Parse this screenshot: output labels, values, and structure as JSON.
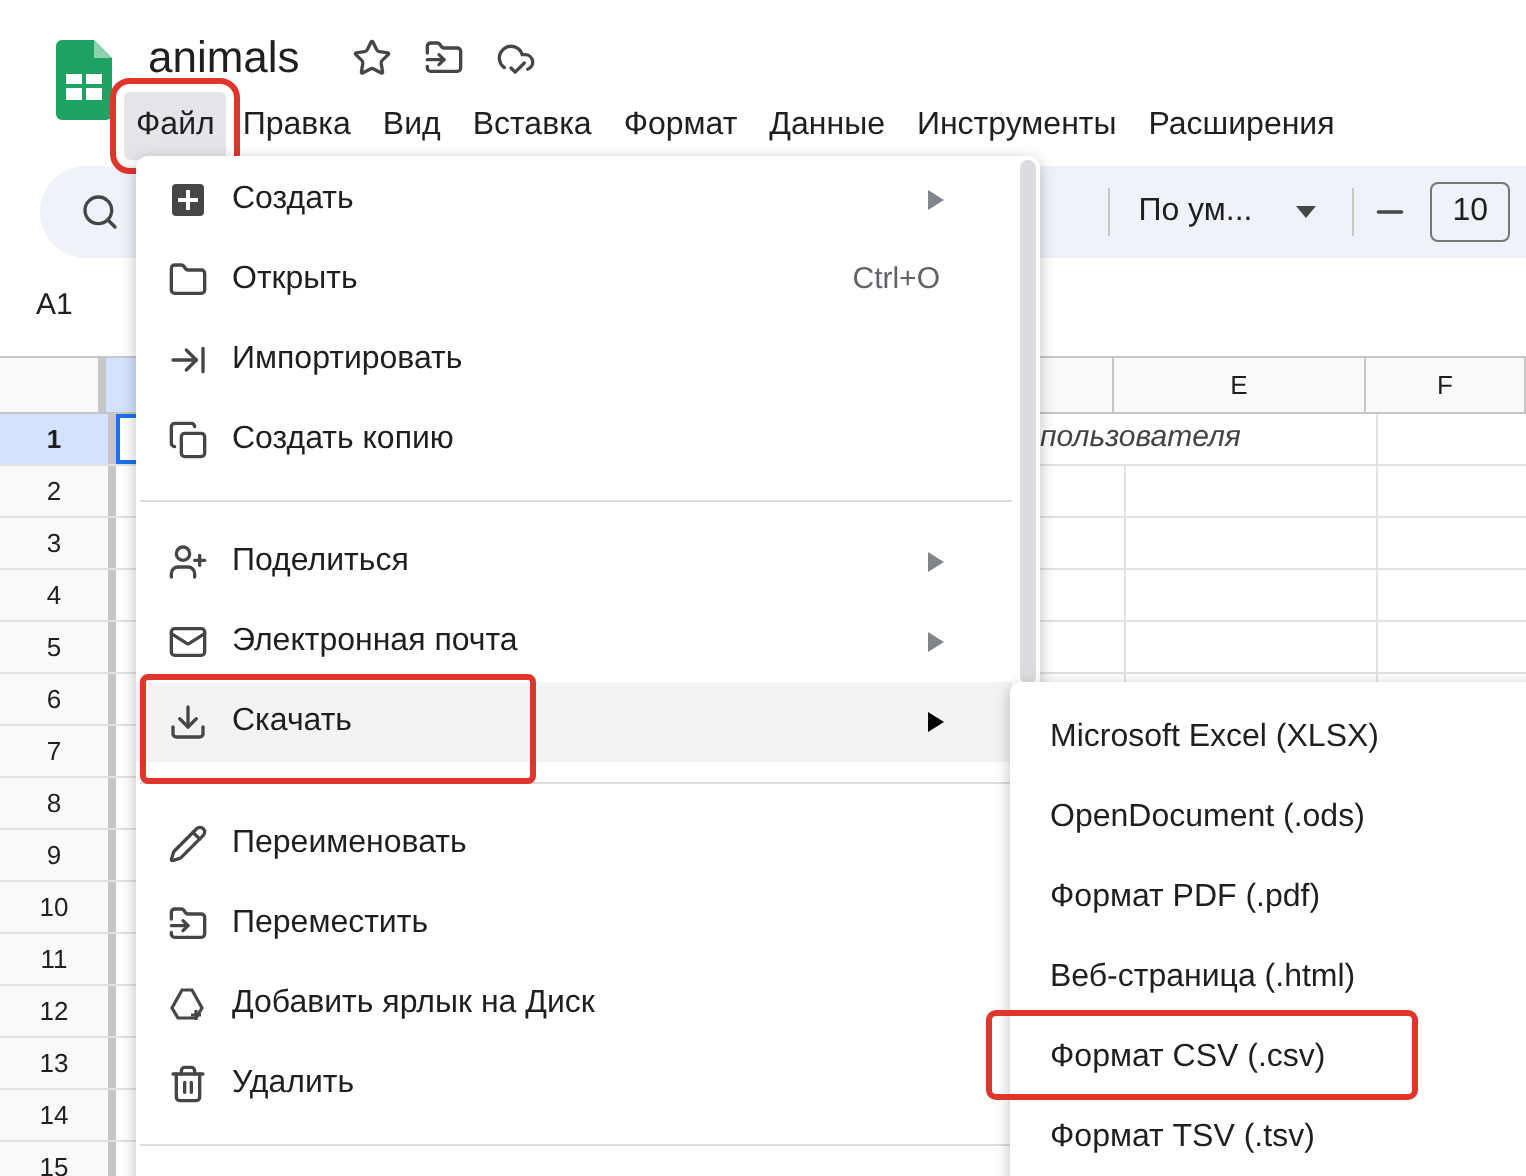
{
  "document": {
    "title": "animals"
  },
  "menubar": [
    {
      "label": "Файл",
      "selected": true,
      "outlined": true
    },
    {
      "label": "Правка",
      "selected": false,
      "outlined": false
    },
    {
      "label": "Вид",
      "selected": false,
      "outlined": false
    },
    {
      "label": "Вставка",
      "selected": false,
      "outlined": false
    },
    {
      "label": "Формат",
      "selected": false,
      "outlined": false
    },
    {
      "label": "Данные",
      "selected": false,
      "outlined": false
    },
    {
      "label": "Инструменты",
      "selected": false,
      "outlined": false
    },
    {
      "label": "Расширения",
      "selected": false,
      "outlined": false
    }
  ],
  "toolbar": {
    "font": "По ум...",
    "font_size": "10"
  },
  "name_box": "A1",
  "grid": {
    "columns": [
      {},
      {},
      {
        "label": "E"
      },
      {
        "label": "F"
      }
    ],
    "rows": [
      {
        "number": "1",
        "selected": true,
        "text": "пользователя"
      },
      {
        "number": "2",
        "selected": false
      },
      {
        "number": "3",
        "selected": false
      },
      {
        "number": "4",
        "selected": false
      },
      {
        "number": "5",
        "selected": false
      },
      {
        "number": "6",
        "selected": false
      },
      {
        "number": "7",
        "selected": false
      },
      {
        "number": "8",
        "selected": false
      },
      {
        "number": "9",
        "selected": false
      },
      {
        "number": "10",
        "selected": false
      },
      {
        "number": "11",
        "selected": false
      },
      {
        "number": "12",
        "selected": false
      },
      {
        "number": "13",
        "selected": false
      },
      {
        "number": "14",
        "selected": false
      },
      {
        "number": "15",
        "selected": false
      }
    ]
  },
  "file_menu": {
    "items": [
      {
        "kind": "item",
        "label": "Создать",
        "submenu": true,
        "selected": false,
        "outlined": false
      },
      {
        "kind": "item",
        "label": "Открыть",
        "shortcut": "Ctrl+O",
        "submenu": false,
        "selected": false,
        "outlined": false
      },
      {
        "kind": "item",
        "label": "Импортировать",
        "submenu": false,
        "selected": false,
        "outlined": false
      },
      {
        "kind": "item",
        "label": "Создать копию",
        "submenu": false,
        "selected": false,
        "outlined": false
      },
      {
        "kind": "divider"
      },
      {
        "kind": "item",
        "label": "Поделиться",
        "submenu": true,
        "selected": false,
        "outlined": false
      },
      {
        "kind": "item",
        "label": "Электронная почта",
        "submenu": true,
        "selected": false,
        "outlined": false
      },
      {
        "kind": "item",
        "label": "Скачать",
        "submenu": true,
        "selected": true,
        "outlined": true
      },
      {
        "kind": "divider"
      },
      {
        "kind": "item",
        "label": "Переименовать",
        "submenu": false,
        "selected": false,
        "outlined": false
      },
      {
        "kind": "item",
        "label": "Переместить",
        "submenu": false,
        "selected": false,
        "outlined": false
      },
      {
        "kind": "item",
        "label": "Добавить ярлык на Диск",
        "submenu": false,
        "selected": false,
        "outlined": false
      },
      {
        "kind": "item",
        "label": "Удалить",
        "submenu": false,
        "selected": false,
        "outlined": false
      },
      {
        "kind": "divider"
      }
    ]
  },
  "download_menu": {
    "items": [
      {
        "label": "Microsoft Excel (XLSX)",
        "outlined": false
      },
      {
        "label": "OpenDocument (.ods)",
        "outlined": false
      },
      {
        "label": "Формат PDF (.pdf)",
        "outlined": false
      },
      {
        "label": "Веб-страница (.html)",
        "outlined": false
      },
      {
        "label": "Формат CSV (.csv)",
        "outlined": true
      },
      {
        "label": "Формат TSV (.tsv)",
        "outlined": false
      }
    ]
  }
}
